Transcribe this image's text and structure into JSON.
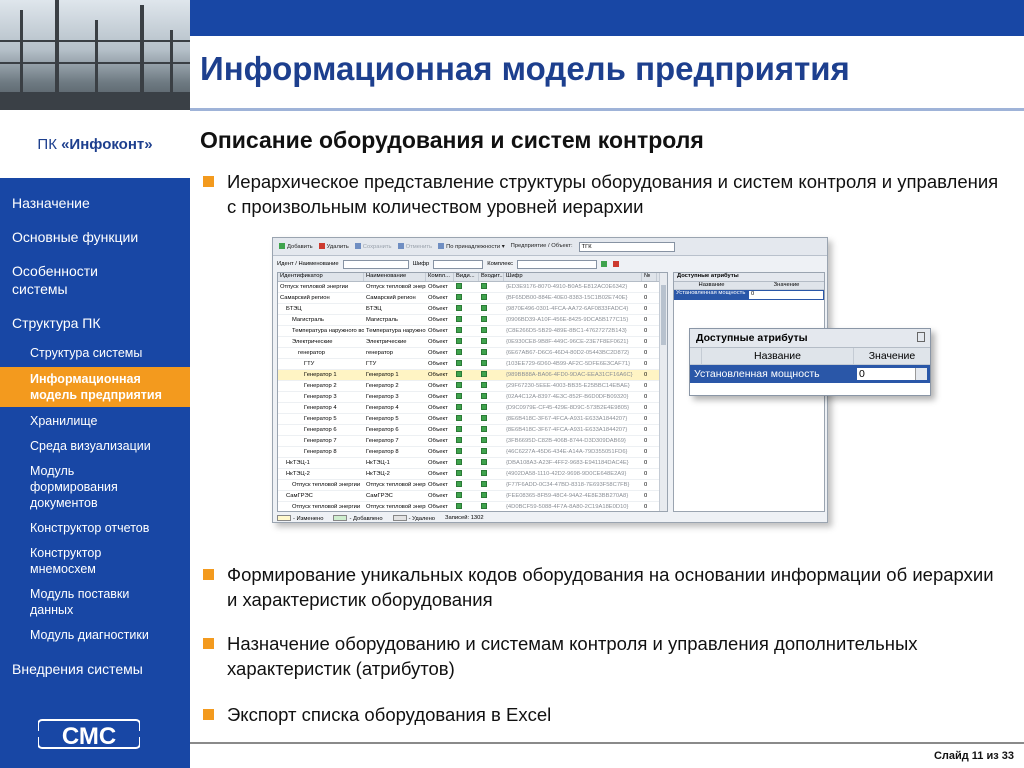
{
  "header": {
    "title": "Информационная модель предприятия"
  },
  "sidebar": {
    "brand_prefix": "ПК ",
    "brand_name": "«Инфоконт»",
    "items": [
      {
        "label": "Назначение"
      },
      {
        "label": "Основные функции"
      },
      {
        "label": "Особенности системы"
      },
      {
        "label": "Структура ПК"
      }
    ],
    "subitems": [
      {
        "label": "Структура системы"
      },
      {
        "label": "Информационная модель предприятия",
        "active": true
      },
      {
        "label": "Хранилище"
      },
      {
        "label": "Среда визуализации"
      },
      {
        "label": "Модуль формирования документов"
      },
      {
        "label": "Конструктор отчетов"
      },
      {
        "label": "Конструктор мнемосхем"
      },
      {
        "label": "Модуль поставки данных"
      },
      {
        "label": "Модуль диагностики"
      }
    ],
    "last_item": "Внедрения системы",
    "logo_text": "СМС"
  },
  "main": {
    "subtitle": "Описание оборудования и систем контроля",
    "bullets": [
      "Иерархическое представление структуры  оборудования и систем контроля и управления с произвольным количеством уровней иерархии",
      "Формирование уникальных кодов оборудования на основании информации об иерархии и характеристик оборудования",
      "Назначение оборудованию и системам контроля и управления дополнительных характеристик (атрибутов)",
      "Экспорт списка оборудования в Excel"
    ]
  },
  "app": {
    "toolbar": {
      "add": "Добавить",
      "delete": "Удалить",
      "save": "Сохранить",
      "cancel": "Отменить",
      "by_owner": "По принадлежности",
      "enterprise_label": "Предприятие / Объект:",
      "enterprise_value": "ТГК"
    },
    "filter": {
      "id_label": "Идент / Наименование",
      "code_label": "Шифр",
      "complex_label": "Комплекс"
    },
    "columns": [
      "Идентификатор",
      "Наименование",
      "Компл...",
      "Види...",
      "Входит...",
      "Шифр",
      "№"
    ],
    "rows": [
      {
        "id": "Отпуск тепловой энергии",
        "name": "Отпуск тепловой энергии",
        "cls": "Объект",
        "code": "{ED3E9176-8070-4910-B0A5-E812AC0E6342}",
        "n": "0"
      },
      {
        "id": "Самарский регион",
        "name": "Самарский регион",
        "cls": "Объект",
        "code": "{BF65DB00-884E-40E0-8383-15C1B02E740E}",
        "n": "0"
      },
      {
        "id": "БТЭЦ",
        "name": "БТЭЦ",
        "cls": "Объект",
        "code": "{9870E496-0301-4FCA-AA72-6AF0833FADC4}",
        "n": "0"
      },
      {
        "id": "Магистраль",
        "name": "Магистраль",
        "cls": "Объект",
        "code": "{0906BD39-A10F-456E-8425-9DCA5B177C15}",
        "n": "0"
      },
      {
        "id": "Температура наружного воздуха",
        "name": "Температура наружного воздуха",
        "cls": "Объект",
        "code": "{C8E266D5-5B29-489E-8BC1-47627272B143}",
        "n": "0"
      },
      {
        "id": "Электрические",
        "name": "Электрические",
        "cls": "Объект",
        "code": "{0E930CE8-9B8F-449C-96CE-23E7F8EF0621}",
        "n": "0"
      },
      {
        "id": "генератор",
        "name": "генератор",
        "cls": "Объект",
        "code": "{6E67AB67-D6C6-46D4-80D2-05443BC2D872}",
        "n": "0"
      },
      {
        "id": "ГТУ",
        "name": "ГТУ",
        "cls": "Объект",
        "code": "{103EE729-6D60-4B99-AF2C-5DFE6E3CAF71}",
        "n": "0"
      },
      {
        "id": "Генератор 1",
        "name": "Генератор 1",
        "cls": "Объект",
        "code": "{989BB88A-BA06-4FD0-9DAC-EEA31CF16A6C}",
        "n": "0",
        "selected": true
      },
      {
        "id": "Генератор 2",
        "name": "Генератор 2",
        "cls": "Объект",
        "code": "{29F67230-5EEE-4003-BB35-E25BBC14EBAE}",
        "n": "0"
      },
      {
        "id": "Генератор 3",
        "name": "Генератор 3",
        "cls": "Объект",
        "code": "{02A4C12A-8397-4E3C-852F-B6D0DFB09320}",
        "n": "0"
      },
      {
        "id": "Генератор 4",
        "name": "Генератор 4",
        "cls": "Объект",
        "code": "{D9C0979E-CF45-429E-8D9C-573B2E4E9805}",
        "n": "0"
      },
      {
        "id": "Генератор 5",
        "name": "Генератор 5",
        "cls": "Объект",
        "code": "{8E6B418C-3F67-4FCA-A931-E633A1844207}",
        "n": "0"
      },
      {
        "id": "Генератор 6",
        "name": "Генератор 6",
        "cls": "Объект",
        "code": "{8E6B418C-3F67-4FCA-A931-E633A1844207}",
        "n": "0"
      },
      {
        "id": "Генератор 7",
        "name": "Генератор 7",
        "cls": "Объект",
        "code": "{3FB6695D-C82B-406B-8744-D3D309DAB69}",
        "n": "0"
      },
      {
        "id": "Генератор 8",
        "name": "Генератор 8",
        "cls": "Объект",
        "code": "{46C6227A-45D6-434E-A14A-79D355051FD6}",
        "n": "0"
      },
      {
        "id": "НкТЭЦ-1",
        "name": "НкТЭЦ-1",
        "cls": "Объект",
        "code": "{DBA108A3-A23F-4FF2-9683-E941184DAC4E}",
        "n": "0"
      },
      {
        "id": "НкТЭЦ-2",
        "name": "НкТЭЦ-2",
        "cls": "Объект",
        "code": "{4902DA58-1110-42D2-9698-9D0CE648E2A9}",
        "n": "0"
      },
      {
        "id": "Отпуск тепловой энергии",
        "name": "Отпуск тепловой энергии",
        "cls": "Объект",
        "code": "{F77F6ADD-0C34-47BD-8318-7E693F58C7FB}",
        "n": "0"
      },
      {
        "id": "СамГРЭС",
        "name": "СамГРЭС",
        "cls": "Объект",
        "code": "{FEE08365-8FB9-48C4-94A2-4E8E3BB270A8}",
        "n": "0"
      },
      {
        "id": "Отпуск тепловой энергии",
        "name": "Отпуск тепловой энергии",
        "cls": "Объект",
        "code": "{4D0BCF59-5088-4F7A-8A80-2C19A18E0D10}",
        "n": "0"
      }
    ],
    "status": {
      "changed": "- Изменено",
      "added": "- Добавлено",
      "deleted": "- Удалено",
      "records": "Записей: 1302"
    },
    "attr_panel": {
      "caption": "Доступные атрибуты",
      "col_name": "Название",
      "col_value": "Значение",
      "row_name": "Установленная мощность",
      "row_value": "0"
    }
  },
  "footer": {
    "slide_number": "Слайд 11 из 33"
  },
  "colors": {
    "brand_blue": "#1847a5",
    "title_blue": "#1d3f8e",
    "accent_orange": "#f39a1e",
    "selection_blue": "#2a57a8"
  }
}
